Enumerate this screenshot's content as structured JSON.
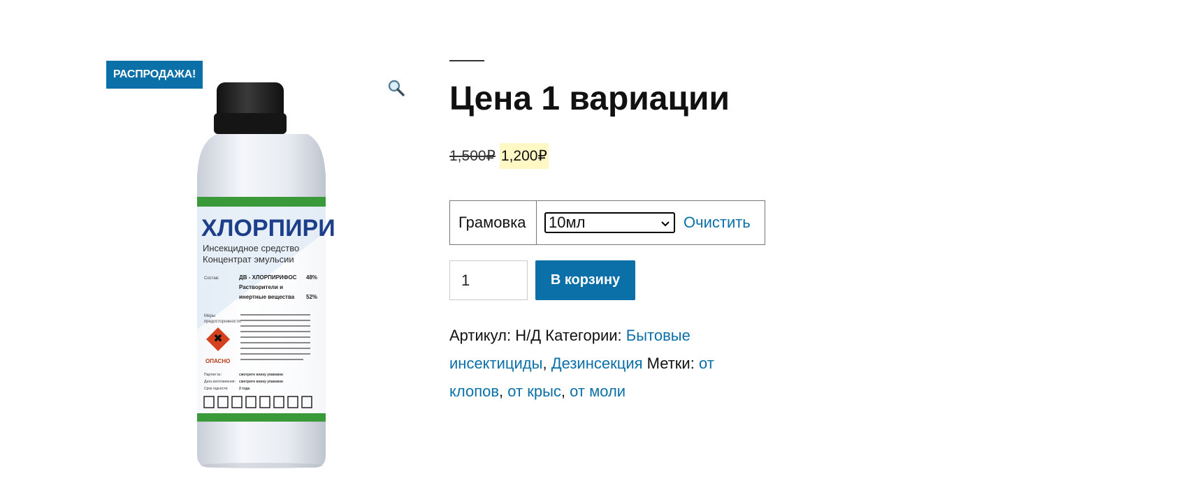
{
  "badge": {
    "sale": "РАСПРОДАЖА!"
  },
  "product_image": {
    "brand_text": "ХЛОРПИРИ",
    "sub1": "Инсекцидное средство",
    "sub2": "Концентрат эмульсии",
    "composition_label": "Состав:",
    "comp1": "ДВ - ХЛОРПИРИФОС",
    "comp1_pct": "48%",
    "comp2": "Растворители и",
    "comp3": "инертные вещества",
    "comp3_pct": "52%",
    "measures_label": "Меры",
    "measures_label2": "предосторожности:",
    "danger_label": "ОПАСНО",
    "batch_label": "Партия №:",
    "batch_value": "смотрите внизу упаковки",
    "date_label": "Дата изготовления:",
    "date_value": "смотрите внизу упаковки",
    "shelf_label": "Срок годности:",
    "shelf_value": "2 года"
  },
  "product": {
    "title": "Цена 1 вариации",
    "price_old": "1,500₽",
    "price_new": "1,200₽"
  },
  "variation": {
    "label": "Грамовка",
    "selected": "10мл",
    "clear": "Очистить"
  },
  "cart": {
    "quantity": "1",
    "add_button": "В корзину"
  },
  "meta": {
    "sku_label": "Артикул:",
    "sku_value": "Н/Д",
    "categories_label": "Категории:",
    "categories": [
      "Бытовые инсектициды",
      "Дезинсекция"
    ],
    "tags_label": "Метки:",
    "tags": [
      "от клопов",
      "от крыс",
      "от моли"
    ]
  }
}
